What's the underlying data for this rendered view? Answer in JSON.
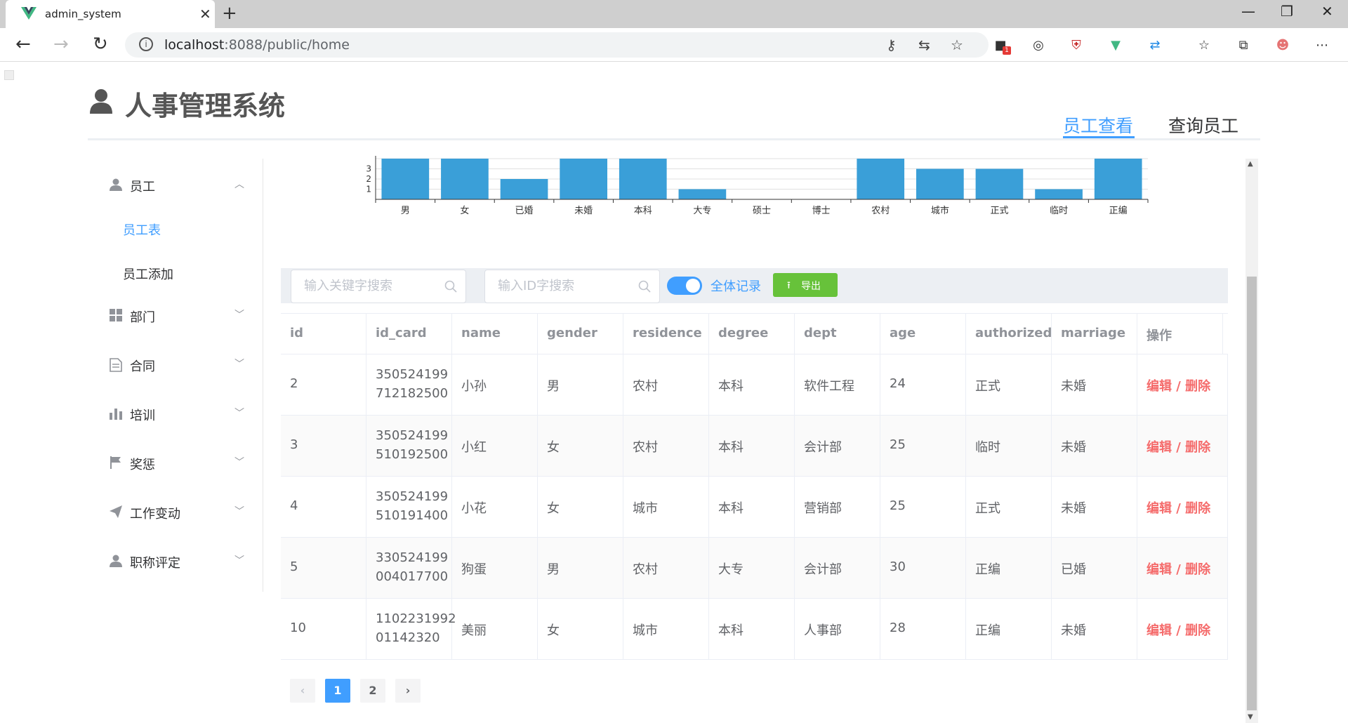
{
  "browser": {
    "tab_title": "admin_system",
    "url_host": "localhost",
    "url_rest": ":8088/public/home",
    "ext_badge": "1"
  },
  "app": {
    "title": "人事管理系统",
    "top_tabs": [
      "员工查看",
      "查询员工"
    ]
  },
  "sidebar": {
    "items": [
      {
        "label": "员工",
        "icon": "user-icon",
        "expanded": true,
        "children": [
          {
            "label": "员工表",
            "active": true
          },
          {
            "label": "员工添加",
            "active": false
          }
        ]
      },
      {
        "label": "部门",
        "icon": "grid-icon"
      },
      {
        "label": "合同",
        "icon": "document-icon"
      },
      {
        "label": "培训",
        "icon": "bar-chart-icon"
      },
      {
        "label": "奖惩",
        "icon": "flag-icon"
      },
      {
        "label": "工作变动",
        "icon": "send-icon"
      },
      {
        "label": "职称评定",
        "icon": "user-icon"
      }
    ]
  },
  "chart_data": {
    "type": "bar",
    "categories": [
      "男",
      "女",
      "已婚",
      "未婚",
      "本科",
      "大专",
      "硕士",
      "博士",
      "农村",
      "城市",
      "正式",
      "临时",
      "正编"
    ],
    "values": [
      4,
      4,
      2,
      4,
      4,
      1,
      0,
      0,
      4,
      3,
      3,
      1,
      4
    ],
    "yticks": [
      "1",
      "2",
      "3"
    ],
    "ylim": [
      0,
      4
    ],
    "bar_color": "#3a9fd8"
  },
  "toolbar": {
    "keyword_placeholder": "输入关键字搜索",
    "id_placeholder": "输入ID字搜索",
    "switch_label": "全体记录",
    "switch_on": true,
    "export_label": "导出"
  },
  "table": {
    "columns": [
      "id",
      "id_card",
      "name",
      "gender",
      "residence",
      "degree",
      "dept",
      "age",
      "authorized",
      "marriage",
      "操作"
    ],
    "rows": [
      {
        "id": "2",
        "id_card_1": "350524199",
        "id_card_2": "712182500",
        "name": "小孙",
        "gender": "男",
        "residence": "农村",
        "degree": "本科",
        "dept": "软件工程",
        "age": "24",
        "authorized": "正式",
        "marriage": "未婚"
      },
      {
        "id": "3",
        "id_card_1": "350524199",
        "id_card_2": "510192500",
        "name": "小红",
        "gender": "女",
        "residence": "农村",
        "degree": "本科",
        "dept": "会计部",
        "age": "25",
        "authorized": "临时",
        "marriage": "未婚"
      },
      {
        "id": "4",
        "id_card_1": "350524199",
        "id_card_2": "510191400",
        "name": "小花",
        "gender": "女",
        "residence": "城市",
        "degree": "本科",
        "dept": "营销部",
        "age": "25",
        "authorized": "正式",
        "marriage": "未婚"
      },
      {
        "id": "5",
        "id_card_1": "330524199",
        "id_card_2": "004017700",
        "name": "狗蛋",
        "gender": "男",
        "residence": "农村",
        "degree": "大专",
        "dept": "会计部",
        "age": "30",
        "authorized": "正编",
        "marriage": "已婚"
      },
      {
        "id": "10",
        "id_card_1": "1102231992",
        "id_card_2": "01142320",
        "name": "美丽",
        "gender": "女",
        "residence": "城市",
        "degree": "本科",
        "dept": "人事部",
        "age": "28",
        "authorized": "正编",
        "marriage": "未婚"
      }
    ],
    "action_edit": "编辑",
    "action_sep": " / ",
    "action_delete": "删除"
  },
  "pagination": {
    "pages": [
      "1",
      "2"
    ],
    "current": "1"
  },
  "colors": {
    "primary": "#409eff",
    "success": "#67c23a",
    "danger": "#f56c6c"
  }
}
